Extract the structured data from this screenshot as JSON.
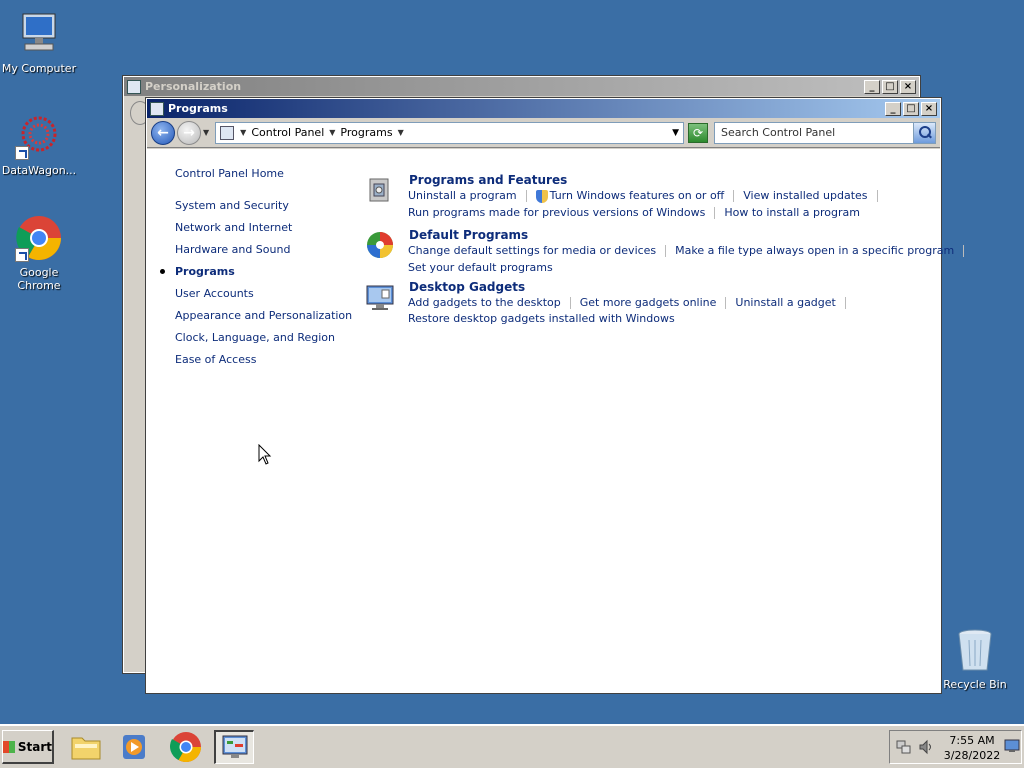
{
  "desktop": {
    "icons": [
      {
        "label": "My Computer"
      },
      {
        "label": "DataWagon..."
      },
      {
        "label": "Google Chrome"
      },
      {
        "label": "Recycle Bin"
      }
    ]
  },
  "back_window": {
    "title": "Personalization"
  },
  "window": {
    "title": "Programs",
    "controls": {
      "minimize": "_",
      "maximize": "□",
      "close": "×"
    },
    "address": {
      "crumbs": [
        "Control Panel",
        "Programs"
      ]
    },
    "search": {
      "placeholder": "Search Control Panel"
    }
  },
  "leftnav": {
    "home": "Control Panel Home",
    "items": [
      "System and Security",
      "Network and Internet",
      "Hardware and Sound",
      "Programs",
      "User Accounts",
      "Appearance and Personalization",
      "Clock, Language, and Region",
      "Ease of Access"
    ],
    "current": "Programs"
  },
  "sections": [
    {
      "title": "Programs and Features",
      "icon": "programs-features-icon",
      "row1": [
        "Uninstall a program",
        "Turn Windows features on or off",
        "View installed updates"
      ],
      "row2": [
        "Run programs made for previous versions of Windows",
        "How to install a program"
      ]
    },
    {
      "title": "Default Programs",
      "icon": "default-programs-icon",
      "row1": [
        "Change default settings for media or devices",
        "Make a file type always open in a specific program"
      ],
      "row2": [
        "Set your default programs"
      ]
    },
    {
      "title": "Desktop Gadgets",
      "icon": "desktop-gadgets-icon",
      "row1": [
        "Add gadgets to the desktop",
        "Get more gadgets online",
        "Uninstall a gadget"
      ],
      "row2": [
        "Restore desktop gadgets installed with Windows"
      ]
    }
  ],
  "taskbar": {
    "start": "Start",
    "clock": {
      "time": "7:55 AM",
      "date": "3/28/2022"
    }
  },
  "colors": {
    "desktop": "#3a6ea5",
    "link": "#0d2c7a"
  }
}
